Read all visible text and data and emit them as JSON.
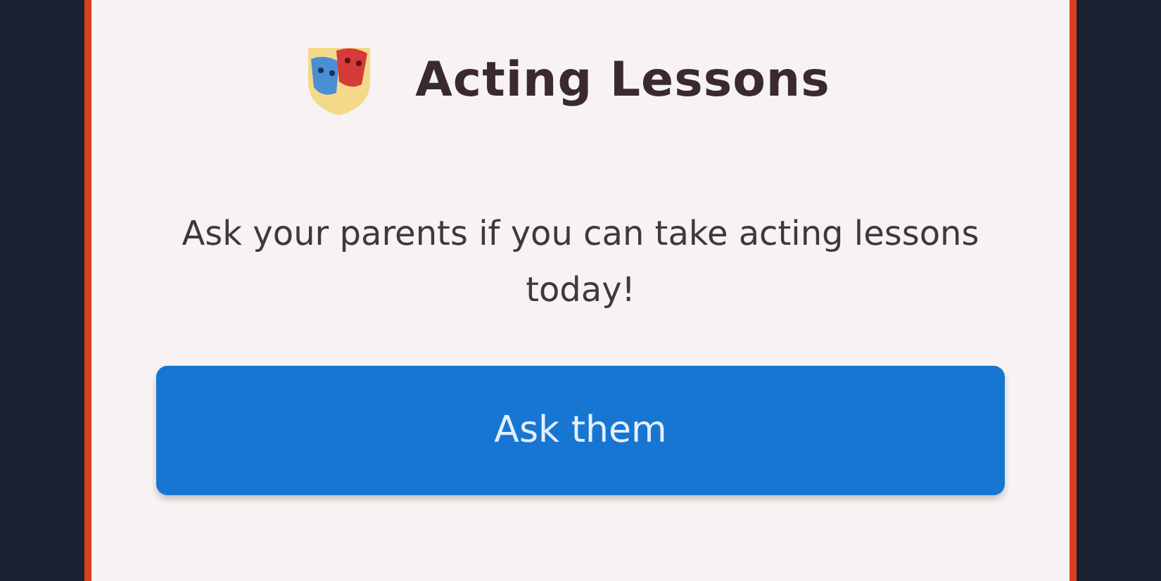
{
  "dialog": {
    "title": "Acting Lessons",
    "message": "Ask your parents if you can take acting lessons today!",
    "button": "Ask them"
  }
}
